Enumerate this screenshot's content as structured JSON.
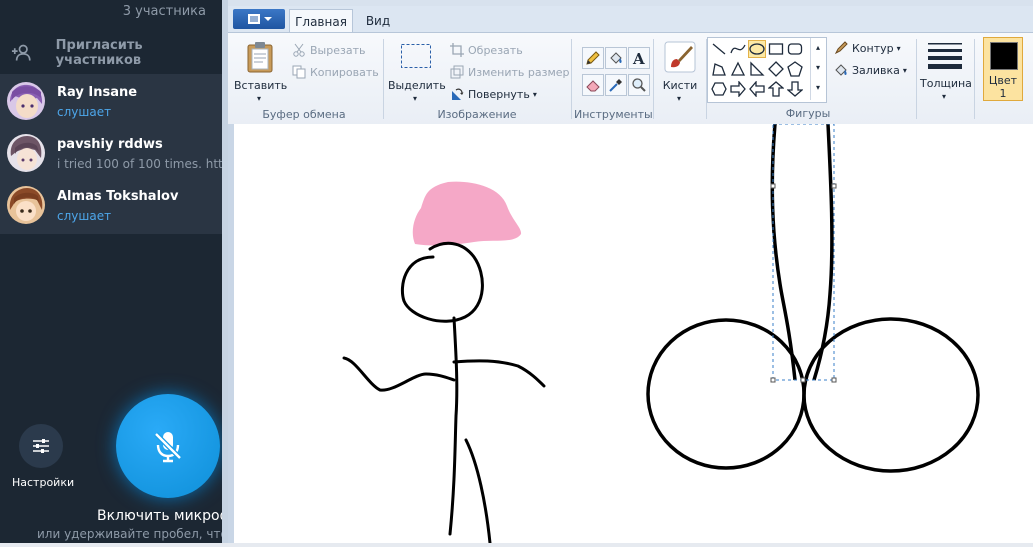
{
  "telegram": {
    "participants_count": "3 участника",
    "invite_label": "Пригласить участников",
    "participants": [
      {
        "name": "Ray Insane",
        "status": "слушает",
        "status_type": "listening"
      },
      {
        "name": "pavshiy rddws",
        "status": "i tried 100 of 100 times. http",
        "status_type": "bio"
      },
      {
        "name": "Almas Tokshalov",
        "status": "слушает",
        "status_type": "listening"
      }
    ],
    "settings_label": "Настройки",
    "mic_label": "Включить микроф",
    "mic_hint": "или удерживайте пробел, что",
    "colors": {
      "bg": "#1c2733",
      "list_bg": "#2a3543",
      "accent": "#4da6ea",
      "mic": "#1a9ee8"
    }
  },
  "paint": {
    "tabs": [
      {
        "label": "Главная",
        "active": true
      },
      {
        "label": "Вид",
        "active": false
      }
    ],
    "clipboard": {
      "paste": "Вставить",
      "cut": "Вырезать",
      "copy": "Копировать",
      "group": "Буфер обмена"
    },
    "image": {
      "select": "Выделить",
      "crop": "Обрезать",
      "resize": "Изменить размер",
      "rotate": "Повернуть",
      "group": "Изображение"
    },
    "tools": {
      "group": "Инструменты"
    },
    "brushes": {
      "label": "Кисти"
    },
    "shapes": {
      "outline": "Контур",
      "fill": "Заливка",
      "group": "Фигуры"
    },
    "size": {
      "label": "Толщина"
    },
    "color1": {
      "label": "Цвет",
      "number": "1",
      "value": "#000000"
    }
  }
}
